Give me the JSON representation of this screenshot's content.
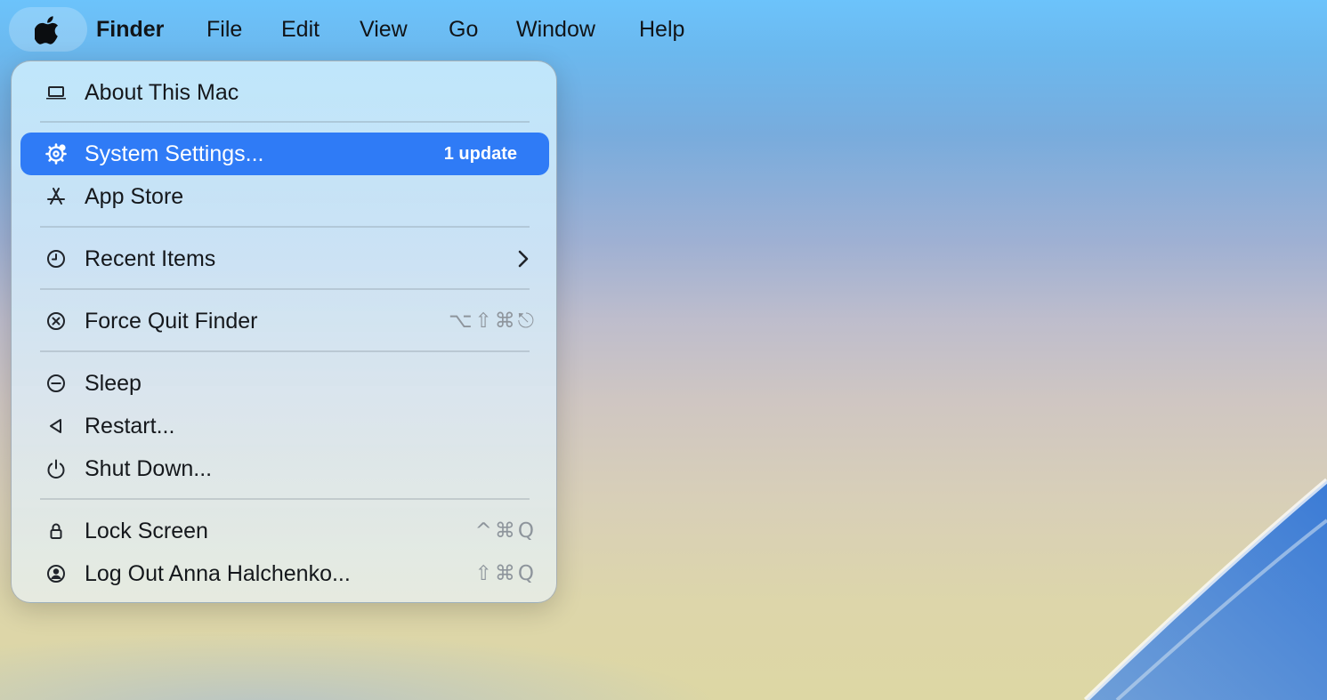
{
  "menubar": {
    "apple_icon": "apple-logo-icon",
    "items": [
      {
        "label": "Finder",
        "bold": true
      },
      {
        "label": "File"
      },
      {
        "label": "Edit"
      },
      {
        "label": "View"
      },
      {
        "label": "Go"
      },
      {
        "label": "Window"
      },
      {
        "label": "Help"
      }
    ]
  },
  "apple_menu": {
    "items": [
      {
        "label": "About This Mac",
        "icon": "laptop-icon"
      },
      {
        "label": "System Settings...",
        "icon": "gear-icon",
        "badge": "1 update",
        "highlighted": true
      },
      {
        "label": "App Store",
        "icon": "app-store-icon"
      },
      {
        "label": "Recent Items",
        "icon": "clock-icon",
        "submenu_icon": "chevron-right-icon"
      },
      {
        "label": "Force Quit Finder",
        "icon": "x-circle-icon",
        "shortcut": "⌥⇧⌘⎋"
      },
      {
        "label": "Sleep",
        "icon": "sleep-icon"
      },
      {
        "label": "Restart...",
        "icon": "restart-icon"
      },
      {
        "label": "Shut Down...",
        "icon": "power-icon"
      },
      {
        "label": "Lock Screen",
        "icon": "lock-icon",
        "shortcut": "^⌘Q"
      },
      {
        "label": "Log Out Anna Halchenko...",
        "icon": "user-circle-icon",
        "shortcut": "⇧⌘Q"
      }
    ]
  },
  "colors": {
    "highlight": "#2f7bf6",
    "menu_text": "#15181c",
    "shortcut_text": "#8e959c"
  }
}
